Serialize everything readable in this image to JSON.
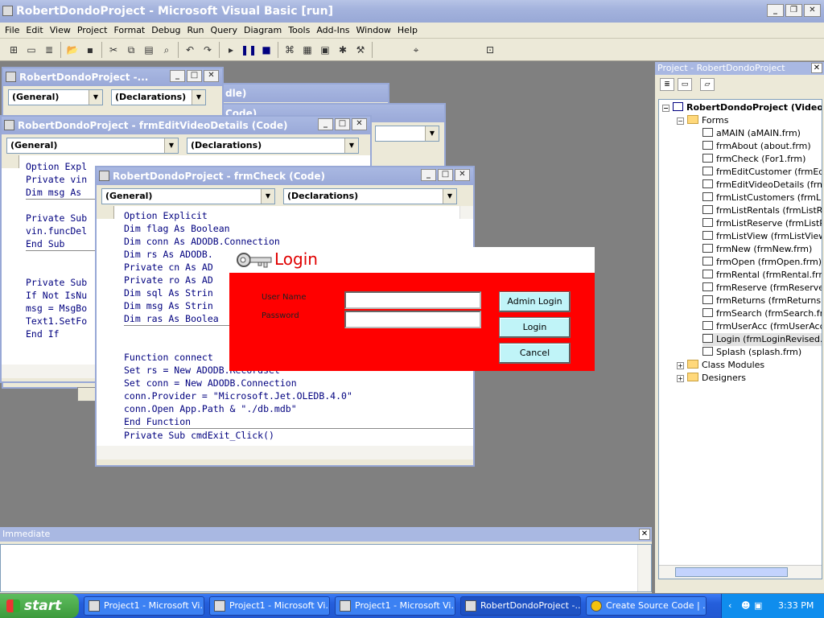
{
  "app": {
    "title": "RobertDondoProject - Microsoft Visual Basic [run]"
  },
  "menu": [
    "File",
    "Edit",
    "View",
    "Project",
    "Format",
    "Debug",
    "Run",
    "Query",
    "Diagram",
    "Tools",
    "Add-Ins",
    "Window",
    "Help"
  ],
  "windows": {
    "w1": {
      "title": "RobertDondoProject -...",
      "combo1": "(General)",
      "combo2": "(Declarations)"
    },
    "w2": {
      "title": "RobertDondoProject - frmEditVideoDetails (Code)",
      "combo1": "(General)",
      "combo2": "(Declarations)",
      "lines": [
        "Option Expl",
        "Private vin",
        "Dim msg As ",
        "",
        "Private Sub",
        "vin.funcDel",
        "End Sub",
        "",
        "",
        "Private Sub",
        "If Not IsNu",
        "msg = MsgBo",
        "Text1.SetFo",
        "End If"
      ]
    },
    "w3": {
      "title": "RobertDondoProject - frmCheck (Code)",
      "combo1": "(General)",
      "combo2": "(Declarations)",
      "lines": [
        "Option Explicit",
        "Dim flag As Boolean",
        "Dim conn As ADODB.Connection",
        "Dim rs As ADODB.",
        "Private cn As AD",
        "Private ro As AD",
        "Dim sql As Strin",
        "Dim msg As Strin",
        "Dim ras As Boolea",
        "",
        "",
        "Function connect",
        "Set rs = New ADODB.Recordset",
        "Set conn = New ADODB.Connection",
        "conn.Provider = \"Microsoft.Jet.OLEDB.4.0\"",
        "conn.Open App.Path & \"./db.mdb\"",
        "End Function",
        "Private Sub cmdExit_Click()"
      ]
    },
    "w_bg1_title": "dle)",
    "w_bg2_title": "Code)"
  },
  "login": {
    "title": "Login",
    "username_label": "User Name",
    "password_label": "Password",
    "username_value": "",
    "password_value": "",
    "admin_button": "Admin Login",
    "login_button": "Login",
    "cancel_button": "Cancel",
    "bg_color": "#ff0000"
  },
  "project": {
    "title": "Project - RobertDondoProject",
    "root": "RobertDondoProject (Video.v",
    "forms_folder": "Forms",
    "forms": [
      "aMAIN (aMAIN.frm)",
      "frmAbout (about.frm)",
      "frmCheck (For1.frm)",
      "frmEditCustomer (frmEditC",
      "frmEditVideoDetails (frmEd",
      "frmListCustomers (frmListC",
      "frmListRentals (frmListRen",
      "frmListReserve (frmListRes",
      "frmListView (frmListView.fr",
      "frmNew (frmNew.frm)",
      "frmOpen (frmOpen.frm)",
      "frmRental (frmRental.frm)",
      "frmReserve (frmReserve.f",
      "frmReturns (frmReturns.fr",
      "frmSearch (frmSearch.frm)",
      "frmUserAcc (frmUserAcc.fr",
      "Login (frmLoginRevised.frr",
      "Splash (splash.frm)"
    ],
    "class_modules": "Class Modules",
    "designers": "Designers"
  },
  "immediate": {
    "title": "Immediate"
  },
  "taskbar": {
    "start": "start",
    "tasks": [
      "Project1 - Microsoft Vi...",
      "Project1 - Microsoft Vi...",
      "Project1 - Microsoft Vi...",
      "RobertDondoProject -...",
      "Create Source Code | ..."
    ],
    "clock": "3:33 PM"
  }
}
